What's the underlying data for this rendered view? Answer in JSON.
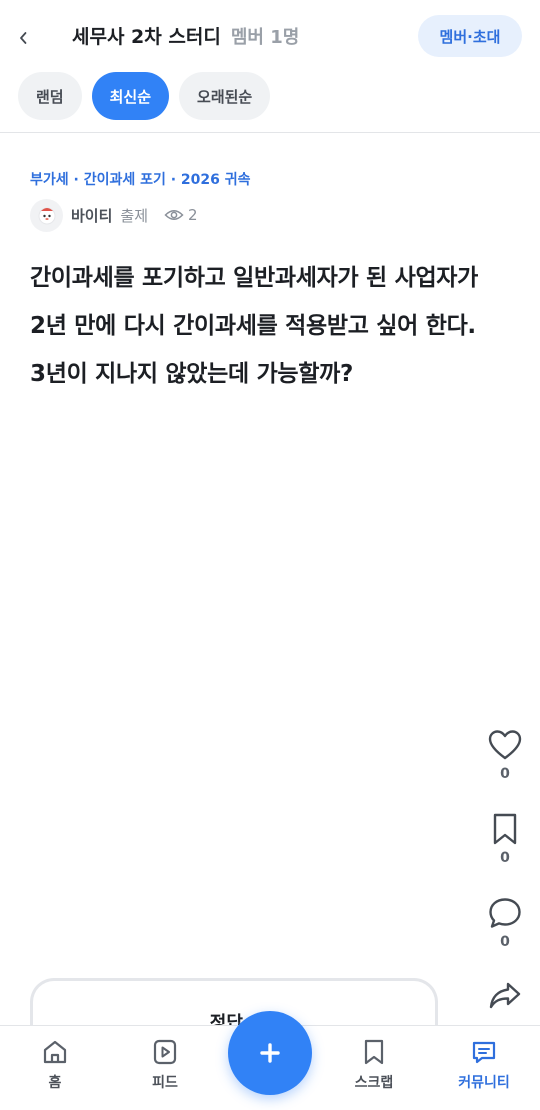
{
  "header": {
    "back_icon": "chevron-left-icon",
    "title": "세무사 2차 스터디",
    "members": "멤버 1명",
    "invite_label": "멤버·초대"
  },
  "sort_tabs": [
    {
      "label": "랜덤",
      "active": false
    },
    {
      "label": "최신순",
      "active": true
    },
    {
      "label": "오래된순",
      "active": false
    }
  ],
  "post": {
    "category": "부가세 · 간이과세 포기 · 2026 귀속",
    "author": "바이티",
    "author_role": "출제",
    "views": "2",
    "question": "간이과세를 포기하고 일반과세자가 된 사업자가 2년 만에 다시 간이과세를 적용받고 싶어 한다. 3년이 지나지 않았는데 가능할까?"
  },
  "actions": {
    "likes": "0",
    "scraps": "0",
    "comments": "0"
  },
  "answer_card": {
    "label": "정답 ▸"
  },
  "bottom_nav": [
    {
      "label": "홈",
      "icon": "home-icon",
      "active": false
    },
    {
      "label": "피드",
      "icon": "play-icon",
      "active": false
    },
    {
      "label": "스크랩",
      "icon": "bookmark-icon",
      "active": false
    },
    {
      "label": "커뮤니티",
      "icon": "chat-icon",
      "active": true
    }
  ],
  "colors": {
    "accent": "#3182f6",
    "accent_text": "#2f6fdd",
    "chip_bg": "#f0f2f4"
  }
}
